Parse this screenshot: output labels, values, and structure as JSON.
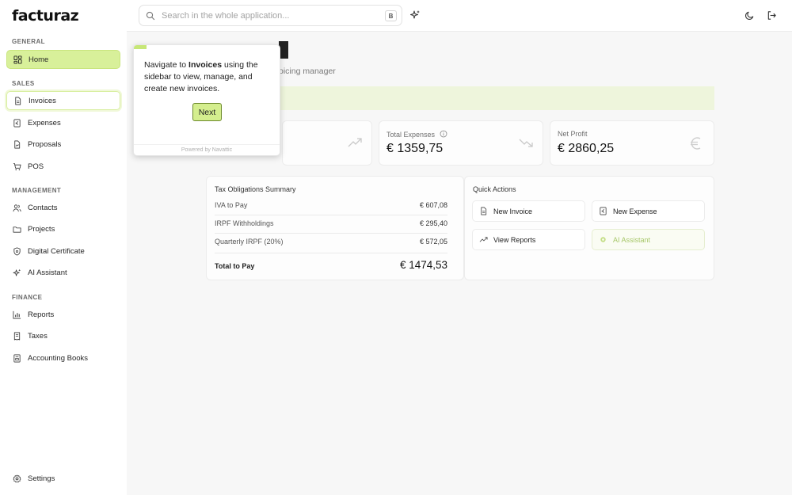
{
  "app": {
    "logo": "facturaz"
  },
  "header": {
    "search_placeholder": "Search in the whole application...",
    "search_shortcut": "B",
    "ai_icon": "sparkles-icon",
    "theme_icon": "moon-icon",
    "logout_icon": "logout-icon"
  },
  "sidebar": {
    "general_label": "GENERAL",
    "home": "Home",
    "sales_label": "SALES",
    "invoices": "Invoices",
    "expenses": "Expenses",
    "proposals": "Proposals",
    "pos": "POS",
    "management_label": "MANAGEMENT",
    "contacts": "Contacts",
    "projects": "Projects",
    "digital_certificate": "Digital Certificate",
    "ai_assistant": "AI Assistant",
    "finance_label": "FINANCE",
    "reports": "Reports",
    "taxes": "Taxes",
    "accounting_books": "Accounting Books",
    "settings": "Settings"
  },
  "dashboard": {
    "subtitle_fragment": "oicing manager",
    "stats": [
      {
        "label": "Total Expenses",
        "value": "€ 1359,75"
      },
      {
        "label": "Net Profit",
        "value": "€ 2860,25"
      }
    ],
    "tax_summary": {
      "title": "Tax Obligations Summary",
      "rows": [
        {
          "label": "IVA to Pay",
          "value": "€ 607,08"
        },
        {
          "label": "IRPF Withholdings",
          "value": "€ 295,40"
        },
        {
          "label": "Quarterly IRPF (20%)",
          "value": "€ 572,05"
        }
      ],
      "total_label": "Total to Pay",
      "total_value": "€ 1474,53"
    },
    "quick_actions": {
      "title": "Quick Actions",
      "new_invoice": "New Invoice",
      "new_expense": "New Expense",
      "view_reports": "View Reports",
      "ai_assistant": "AI Assistant"
    }
  },
  "tooltip": {
    "text_before": "Navigate to ",
    "text_bold": "Invoices",
    "text_after": " using the sidebar to view, manage, and create new invoices.",
    "next_label": "Next",
    "footer": "Powered by Navattic"
  },
  "colors": {
    "accent": "#d8f09a",
    "accent_border": "#c9e57e"
  }
}
